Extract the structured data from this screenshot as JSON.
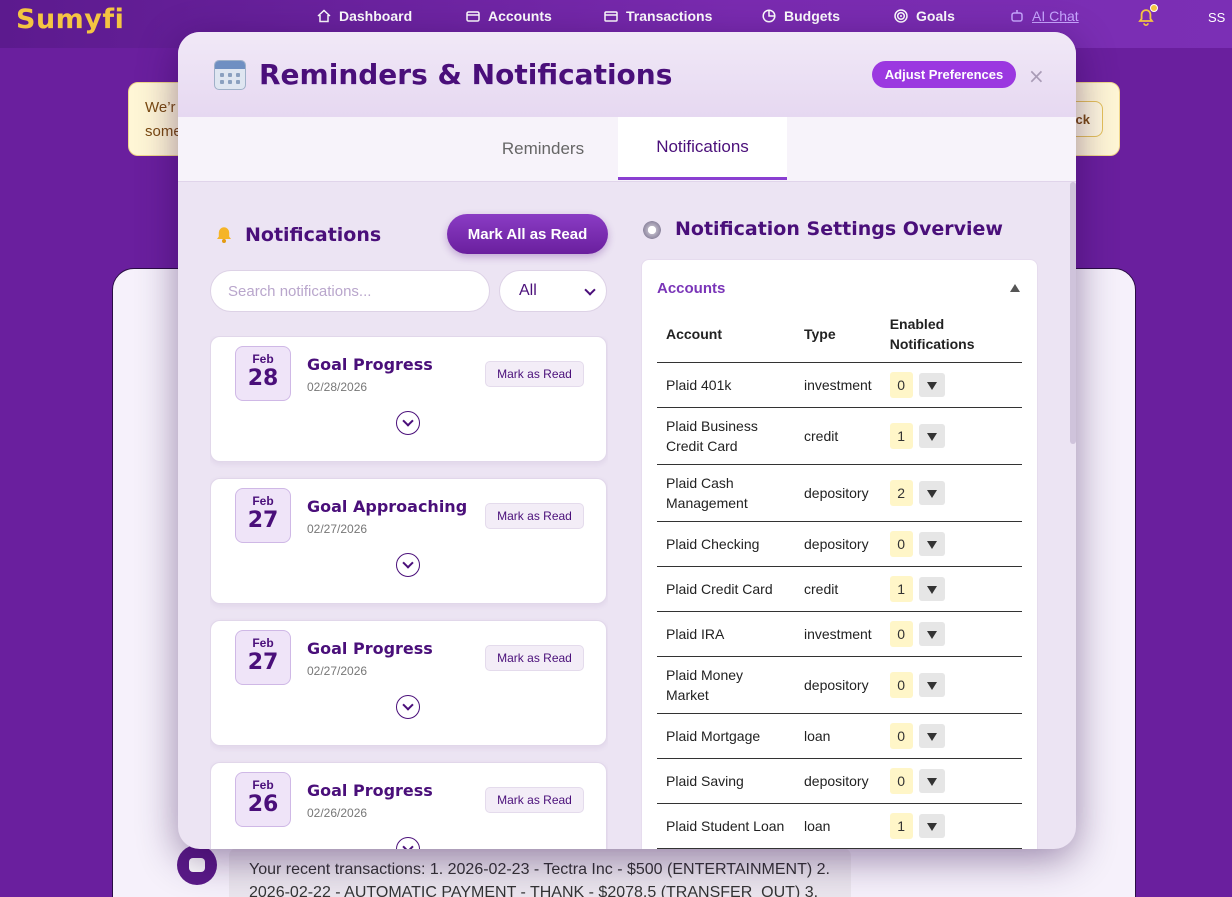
{
  "app": {
    "logo": "Sumyfi",
    "user_initials": "SS"
  },
  "nav": [
    {
      "label": "Dashboard",
      "icon": "home-icon"
    },
    {
      "label": "Accounts",
      "icon": "wallet-icon"
    },
    {
      "label": "Transactions",
      "icon": "card-icon"
    },
    {
      "label": "Budgets",
      "icon": "pie-icon"
    },
    {
      "label": "Goals",
      "icon": "target-icon"
    },
    {
      "label": "AI Chat",
      "icon": "robot-icon"
    }
  ],
  "background": {
    "banner_line1": "We’r",
    "banner_line2": "some",
    "banner_button": "ck",
    "chat_message": "Your recent transactions: 1. 2026-02-23 - Tectra Inc - $500 (ENTERTAINMENT) 2. 2026-02-22 - AUTOMATIC PAYMENT - THANK - $2078.5 (TRANSFER_OUT) 3."
  },
  "modal": {
    "title": "Reminders & Notifications",
    "adjust_button": "Adjust Preferences",
    "close": "×",
    "tabs": {
      "reminders": "Reminders",
      "notifications": "Notifications"
    }
  },
  "notifications": {
    "heading": "Notifications",
    "mark_all": "Mark All as Read",
    "search_placeholder": "Search notifications...",
    "filter_value": "All",
    "mark_label": "Mark as Read",
    "items": [
      {
        "month": "Feb",
        "day": "28",
        "title": "Goal Progress",
        "date": "02/28/2026"
      },
      {
        "month": "Feb",
        "day": "27",
        "title": "Goal Approaching",
        "date": "02/27/2026"
      },
      {
        "month": "Feb",
        "day": "27",
        "title": "Goal Progress",
        "date": "02/27/2026"
      },
      {
        "month": "Feb",
        "day": "26",
        "title": "Goal Progress",
        "date": "02/26/2026"
      }
    ]
  },
  "settings": {
    "heading": "Notification Settings Overview",
    "section": "Accounts",
    "columns": {
      "account": "Account",
      "type": "Type",
      "enabled": "Enabled Notifications"
    },
    "rows": [
      {
        "account": "Plaid 401k",
        "type": "investment",
        "count": "0"
      },
      {
        "account": "Plaid Business Credit Card",
        "type": "credit",
        "count": "1"
      },
      {
        "account": "Plaid Cash Management",
        "type": "depository",
        "count": "2"
      },
      {
        "account": "Plaid Checking",
        "type": "depository",
        "count": "0"
      },
      {
        "account": "Plaid Credit Card",
        "type": "credit",
        "count": "1"
      },
      {
        "account": "Plaid IRA",
        "type": "investment",
        "count": "0"
      },
      {
        "account": "Plaid Money Market",
        "type": "depository",
        "count": "0"
      },
      {
        "account": "Plaid Mortgage",
        "type": "loan",
        "count": "0"
      },
      {
        "account": "Plaid Saving",
        "type": "depository",
        "count": "0"
      },
      {
        "account": "Plaid Student Loan",
        "type": "loan",
        "count": "1"
      }
    ]
  },
  "colors": {
    "brand": "#6a1f9e",
    "accent": "#9b38e0",
    "logo": "#f4c542"
  }
}
